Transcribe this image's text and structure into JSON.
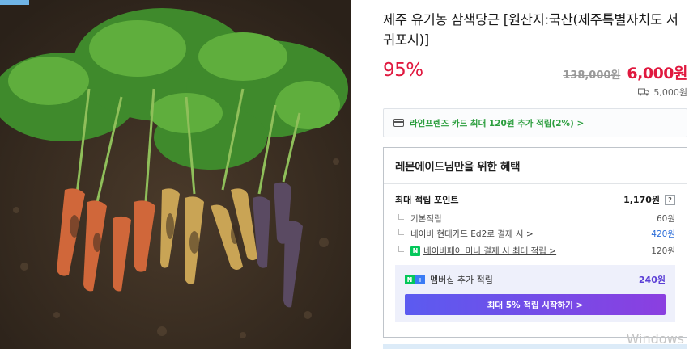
{
  "product": {
    "title": "제주 유기농 삼색당근 [원산지:국산(제주특별자치도 서귀포시)]",
    "discount_rate": "95%",
    "original_price": "138,000원",
    "sale_price": "6,000원",
    "shipping_fee": "5,000원"
  },
  "card_banner": {
    "text": "라인프렌즈 카드 최대 120원 추가 적립(2%) >"
  },
  "benefits": {
    "title": "레몬에이드님만을 위한 혜택",
    "max_points_label": "최대 적립 포인트",
    "max_points_value": "1,170원",
    "help_label": "?",
    "rows": [
      {
        "label": "기본적립",
        "value": "60원"
      },
      {
        "label": "네이버 현대카드 Ed2로 결제 시 >",
        "value": "420원"
      },
      {
        "label": "네이버페이 머니 결제 시 최대 적립 >",
        "value": "120원"
      }
    ],
    "member": {
      "label": "멤버십 추가 적립",
      "value": "240원",
      "button": "최대 5% 적립 시작하기 >"
    }
  },
  "watermark": "Windows",
  "colors": {
    "discount": "#e0193f",
    "points_link": "#2b6dd9",
    "card_banner": "#2c9e3e",
    "membership": "#5b3fd6"
  }
}
